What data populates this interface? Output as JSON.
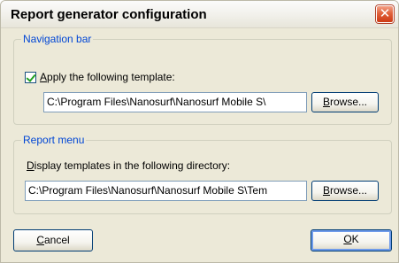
{
  "window": {
    "title": "Report generator configuration",
    "close_glyph": "✕"
  },
  "navigation_bar": {
    "legend": "Navigation bar",
    "checkbox_checked": true,
    "checkbox_label_accel": "A",
    "checkbox_label_rest": "pply the following template:",
    "template_path": "C:\\Program Files\\Nanosurf\\Nanosurf Mobile S\\",
    "browse_accel": "B",
    "browse_rest": "rowse..."
  },
  "report_menu": {
    "legend": "Report menu",
    "label_accel": "D",
    "label_rest": "isplay templates in the following directory:",
    "directory_path": "C:\\Program Files\\Nanosurf\\Nanosurf Mobile S\\Tem",
    "browse_accel": "B",
    "browse_rest": "rowse..."
  },
  "footer": {
    "cancel_accel": "C",
    "cancel_rest": "ancel",
    "ok_accel": "O",
    "ok_rest": "K"
  },
  "colors": {
    "legend_text": "#0046d5",
    "dialog_bg": "#ece9d8",
    "close_button": "#e0613b",
    "checkmark": "#21a121"
  }
}
